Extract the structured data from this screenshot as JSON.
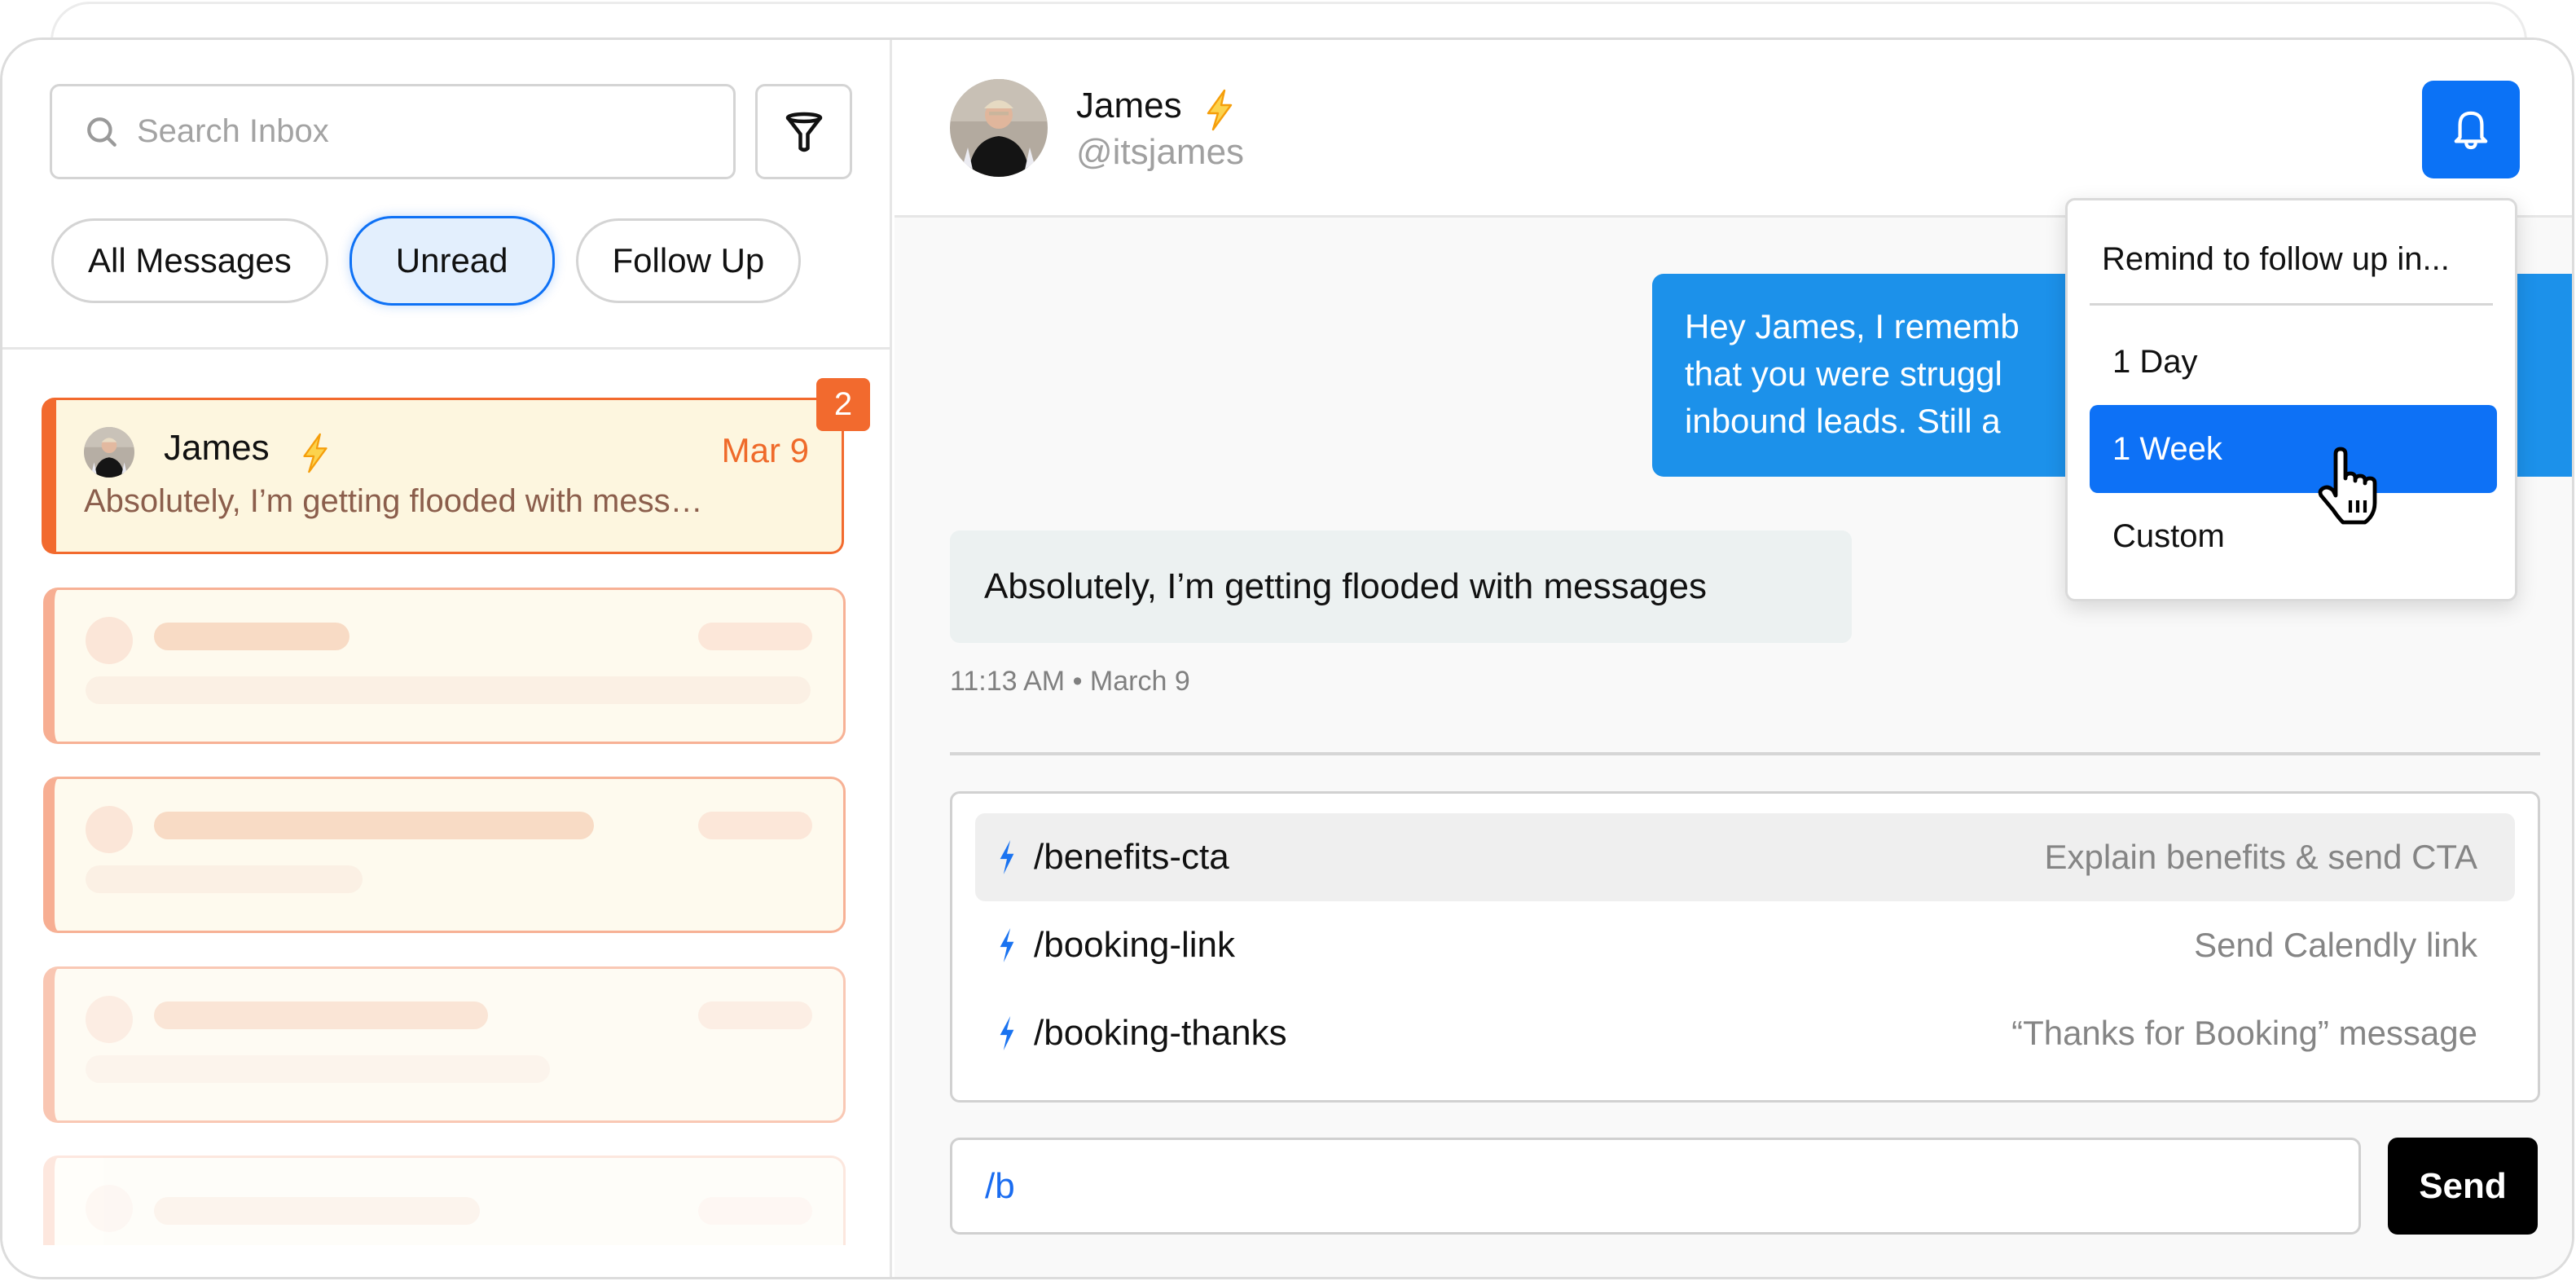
{
  "sidebar": {
    "search": {
      "placeholder": "Search Inbox",
      "value": "",
      "icon": "search-icon"
    },
    "filter_button": {
      "icon": "filter-funnel-icon"
    },
    "tabs": [
      {
        "label": "All Messages",
        "active": false
      },
      {
        "label": "Unread",
        "active": true
      },
      {
        "label": "Follow Up",
        "active": false
      }
    ],
    "conversations": [
      {
        "name": "James",
        "name_icon": "lightning-icon",
        "date": "Mar 9",
        "preview": "Absolutely, I’m getting flooded with mess…",
        "unread_count": "2",
        "active": true
      }
    ],
    "placeholder_cards": 4
  },
  "chat": {
    "header": {
      "name": "James",
      "name_icon": "lightning-icon",
      "handle": "@itsjames",
      "reminder_button_icon": "bell-icon"
    },
    "messages": [
      {
        "direction": "outgoing",
        "lines_visible": [
          "Hey James, I rememb",
          "that you were struggl",
          "inbound leads. Still a"
        ]
      },
      {
        "direction": "incoming",
        "text": "Absolutely, I’m getting flooded with messages",
        "meta": "11:13 AM • March 9"
      }
    ],
    "suggestions": [
      {
        "command": "/benefits-cta",
        "description": "Explain benefits & send CTA",
        "highlighted": true,
        "icon": "lightning-icon"
      },
      {
        "command": "/booking-link",
        "description": "Send Calendly link",
        "highlighted": false,
        "icon": "lightning-icon"
      },
      {
        "command": "/booking-thanks",
        "description": "“Thanks for Booking” message",
        "highlighted": false,
        "icon": "lightning-icon"
      }
    ],
    "composer": {
      "value": "/b",
      "send_label": "Send"
    }
  },
  "reminder_menu": {
    "title": "Remind to follow up in...",
    "options": [
      {
        "label": "1 Day",
        "selected": false
      },
      {
        "label": "1 Week",
        "selected": true
      },
      {
        "label": "Custom",
        "selected": false
      }
    ]
  },
  "colors": {
    "accent_blue": "#0d71f6",
    "outgoing_bubble": "#1c91ea",
    "unread_orange": "#f26a2e",
    "card_fill": "#fdf6df",
    "preview_text": "#8b5e4c"
  }
}
